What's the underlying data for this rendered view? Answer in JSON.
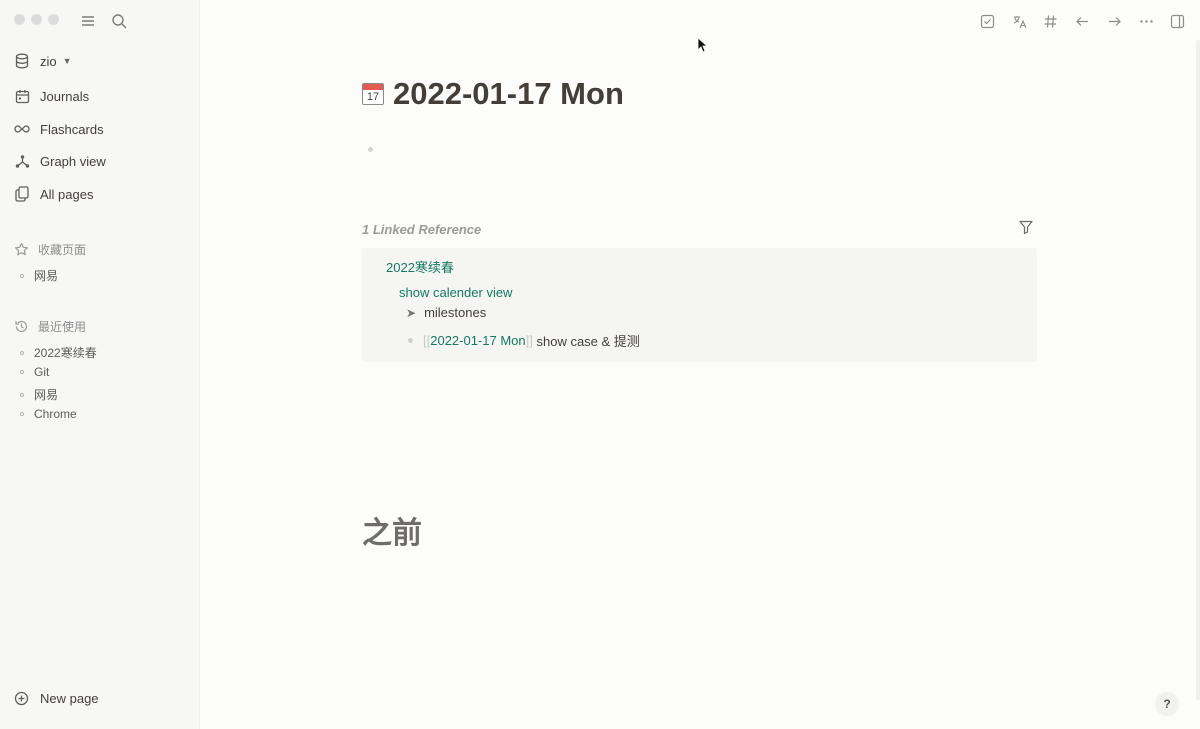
{
  "sidebar": {
    "graph_name": "zio",
    "nav": [
      {
        "label": "Journals",
        "icon": "calendar-icon"
      },
      {
        "label": "Flashcards",
        "icon": "infinity-icon"
      },
      {
        "label": "Graph view",
        "icon": "graph-icon"
      },
      {
        "label": "All pages",
        "icon": "pages-icon"
      }
    ],
    "favorites": {
      "title": "收藏页面",
      "items": [
        "网易"
      ]
    },
    "recent": {
      "title": "最近使用",
      "items": [
        "2022寒续春",
        "Git",
        "网易",
        "Chrome"
      ]
    },
    "new_page_label": "New page"
  },
  "page": {
    "title": "2022-01-17 Mon",
    "calendar_icon_number": "17",
    "linked_refs": {
      "heading": "1 Linked Reference",
      "page": "2022寒续春",
      "parent_block": "show calender view",
      "child_collapsed": "milestones",
      "ref_bracket_open": "[[",
      "ref_link": "2022-01-17 Mon",
      "ref_bracket_close": "]]",
      "ref_rest": " show case & 提测"
    },
    "section_heading": "之前"
  },
  "help_label": "?"
}
